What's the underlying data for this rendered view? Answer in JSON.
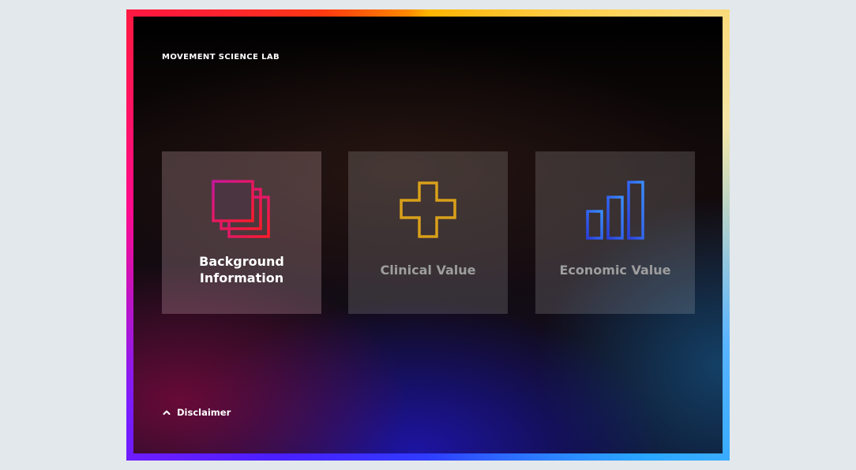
{
  "header": {
    "brand": "MOVEMENT SCIENCE LAB"
  },
  "cards": [
    {
      "label": "Background Information",
      "icon": "stacked-squares-icon",
      "active": true,
      "accent": [
        "#c8169c",
        "#ff1a2a"
      ]
    },
    {
      "label": "Clinical Value",
      "icon": "plus-cross-icon",
      "active": false,
      "accent": [
        "#d9a01a"
      ]
    },
    {
      "label": "Economic Value",
      "icon": "bar-chart-icon",
      "active": false,
      "accent": [
        "#2a45e0",
        "#3b8cff"
      ]
    }
  ],
  "footer": {
    "disclaimer_label": "Disclaimer",
    "disclaimer_icon": "chevron-up-icon"
  },
  "frame_colors": [
    "#ff8a00",
    "#ffd35a",
    "#2aa8ff",
    "#2f3cff",
    "#7a1cff",
    "#ff0a8c",
    "#ff1a3a"
  ]
}
